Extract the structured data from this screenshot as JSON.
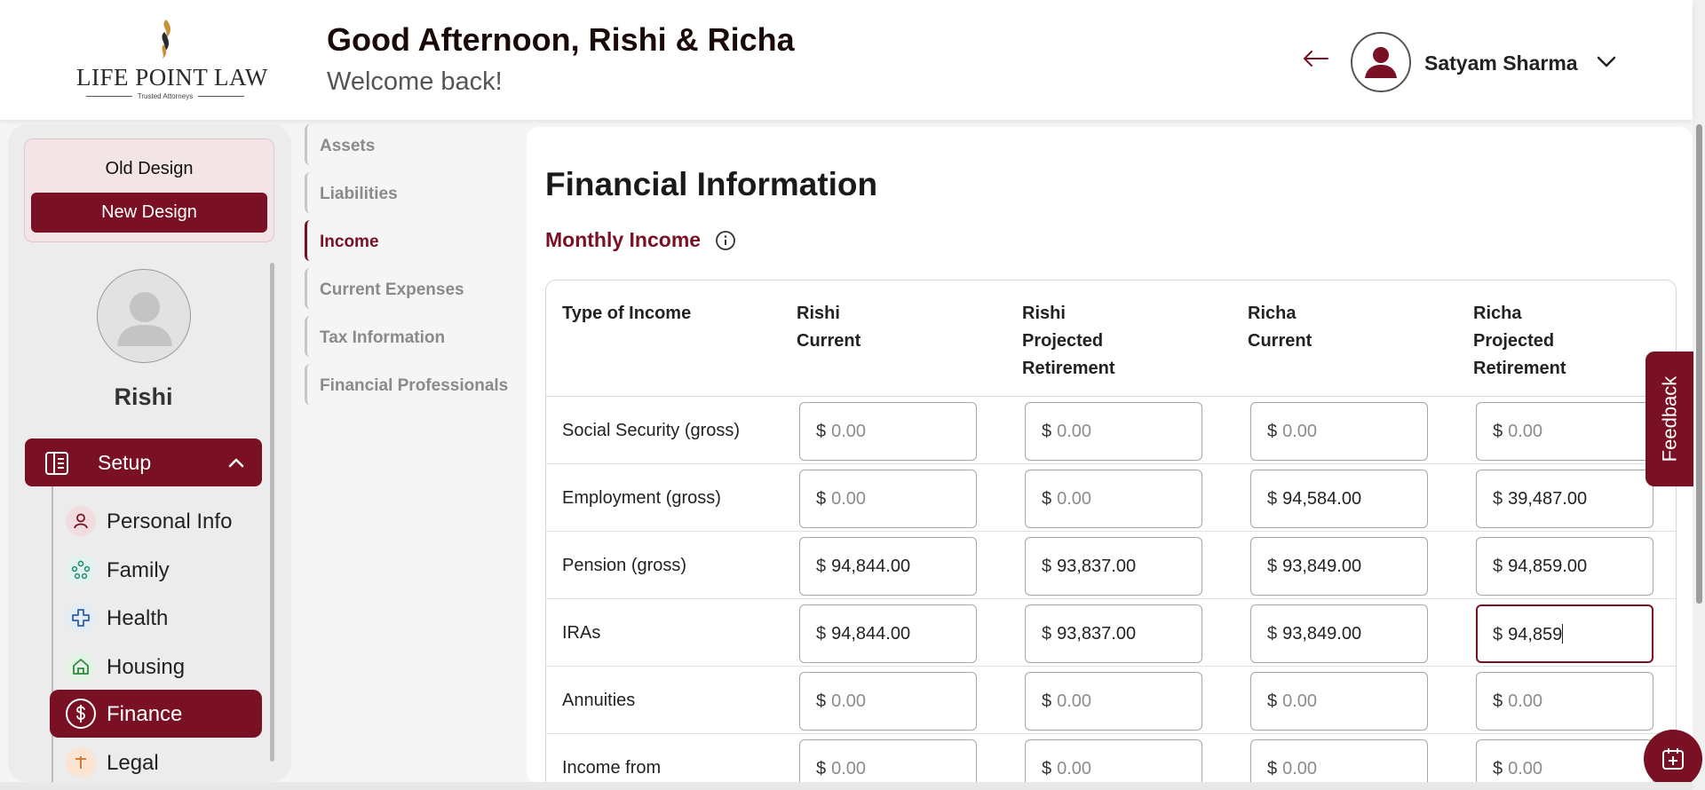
{
  "header": {
    "logo_text": "LIFE POINT LAW",
    "logo_tagline": "Trusted Attorneys",
    "greeting": "Good Afternoon, Rishi & Richa",
    "welcome": "Welcome back!",
    "user_name": "Satyam Sharma"
  },
  "sidebar": {
    "old_design_label": "Old Design",
    "new_design_label": "New Design",
    "profile_name": "Rishi",
    "setup_label": "Setup",
    "items": [
      {
        "label": "Personal Info",
        "icon": "person-icon"
      },
      {
        "label": "Family",
        "icon": "family-icon"
      },
      {
        "label": "Health",
        "icon": "health-cross-icon"
      },
      {
        "label": "Housing",
        "icon": "home-icon"
      },
      {
        "label": "Finance",
        "icon": "dollar-icon",
        "active": true
      },
      {
        "label": "Legal",
        "icon": "legal-icon"
      }
    ]
  },
  "subnav": {
    "items": [
      "Assets",
      "Liabilities",
      "Income",
      "Current Expenses",
      "Tax Information",
      "Financial Professionals"
    ],
    "active": "Income"
  },
  "main": {
    "title": "Financial Information",
    "section_title": "Monthly Income",
    "table": {
      "headers": [
        [
          "Type of Income"
        ],
        [
          "Rishi",
          "Current"
        ],
        [
          "Rishi",
          "Projected",
          "Retirement"
        ],
        [
          "Richa",
          "Current"
        ],
        [
          "Richa",
          "Projected",
          "Retirement"
        ]
      ],
      "currency_symbol": "$",
      "rows": [
        {
          "label": "Social Security (gross)",
          "values": [
            "0.00",
            "0.00",
            "0.00",
            "0.00"
          ],
          "placeholder": [
            true,
            true,
            true,
            true
          ]
        },
        {
          "label": "Employment (gross)",
          "values": [
            "0.00",
            "0.00",
            "94,584.00",
            "39,487.00"
          ],
          "placeholder": [
            true,
            true,
            false,
            false
          ]
        },
        {
          "label": "Pension (gross)",
          "values": [
            "94,844.00",
            "93,837.00",
            "93,849.00",
            "94,859.00"
          ],
          "placeholder": [
            false,
            false,
            false,
            false
          ]
        },
        {
          "label": "IRAs",
          "values": [
            "94,844.00",
            "93,837.00",
            "93,849.00",
            "94,859"
          ],
          "placeholder": [
            false,
            false,
            false,
            false
          ]
        },
        {
          "label": "Annuities",
          "values": [
            "0.00",
            "0.00",
            "0.00",
            "0.00"
          ],
          "placeholder": [
            true,
            true,
            true,
            true
          ]
        },
        {
          "label": "Income from",
          "values": [
            "0.00",
            "0.00",
            "0.00",
            "0.00"
          ],
          "placeholder": [
            true,
            true,
            true,
            true
          ]
        }
      ],
      "focused_cell": "IRAs / Richa Projected Retirement"
    }
  },
  "feedback_label": "Feedback",
  "colors": {
    "brand": "#7a1024",
    "background": "#f5f5f5"
  }
}
